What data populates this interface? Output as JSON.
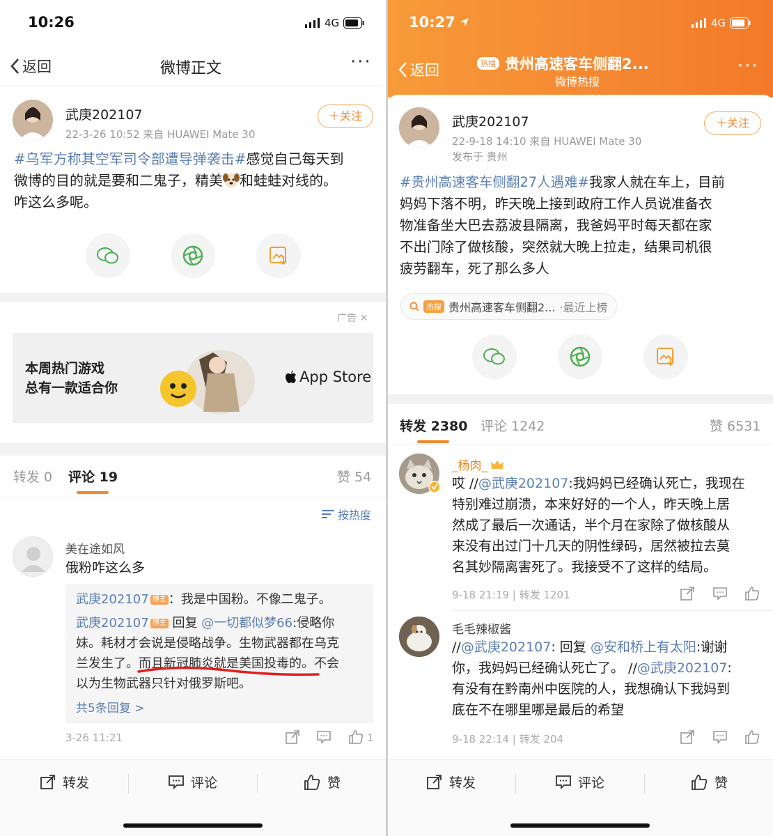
{
  "left": {
    "status": {
      "time": "10:26",
      "network": "4G"
    },
    "nav": {
      "back": "返回",
      "title": "微博正文",
      "more": "···"
    },
    "post": {
      "username": "武庚202107",
      "meta": "22-3-26 10:52  来自 HUAWEI Mate 30",
      "follow": "＋关注",
      "hashtag": "#乌军方称其空军司令部遭导弹袭击#",
      "text1": "感觉自己每天到",
      "text2a": "微博的目的就是要和二鬼子，精美",
      "text2b": "和蛙蛙对线的。",
      "text3": "咋这么多呢。"
    },
    "ad": {
      "label": "广告",
      "close": "✕",
      "line1": "本周热门游戏",
      "line2": "总有一款适合你",
      "store": "App Store"
    },
    "tabs": {
      "repost": "转发 0",
      "comment": "评论 19",
      "like": "赞 54",
      "sort": "按热度"
    },
    "comment": {
      "name": "美在途如风",
      "text": "俄粉咋这么多",
      "reply1_user": "武庚202107",
      "badge": "博主",
      "reply1_text": "：我是中国粉。不像二鬼子。",
      "reply2_user": "武庚202107",
      "reply2_pre": " 回复 ",
      "reply2_mention": "@一切都似梦66",
      "reply2_text1": ":侵略你",
      "reply2_line2": "妹。耗材才会说是侵略战争。生物武器都在乌克",
      "reply2_line3a": "兰发生了。",
      "reply2_line3b": "而且新冠肺炎就是美国投毒的",
      "reply2_line3c": "。不会",
      "reply2_line4": "以为生物武器只针对俄罗斯吧。",
      "more_replies": "共5条回复 >",
      "time": "3-26 11:21",
      "like_count": "1"
    },
    "bottom": {
      "repost": "转发",
      "comment": "评论",
      "like": "赞"
    }
  },
  "right": {
    "status": {
      "time": "10:27",
      "network": "4G"
    },
    "nav": {
      "back": "返回",
      "hot_tag": "热搜",
      "title": "贵州高速客车侧翻2...",
      "subtitle": "微博热搜",
      "more": "···"
    },
    "post": {
      "username": "武庚202107",
      "meta": "22-9-18 14:10  来自 HUAWEI Mate 30",
      "location": "发布于 贵州",
      "follow": "＋关注",
      "hashtag": "#贵州高速客车侧翻27人遇难#",
      "text1": "我家人就在车上，目前",
      "text2": "妈妈下落不明，昨天晚上接到政府工作人员说准备衣",
      "text3": "物准备坐大巴去荔波县隔离，我爸妈平时每天都在家",
      "text4": "不出门除了做核酸，突然就大晚上拉走，结果司机很",
      "text5": "疲劳翻车，死了那么多人"
    },
    "hot_chip": {
      "tag": "热搜",
      "text": "贵州高速客车侧翻2...",
      "suffix": "·最近上榜"
    },
    "tabs": {
      "repost": "转发 2380",
      "comment": "评论 1242",
      "like": "赞 6531"
    },
    "comment1": {
      "name": "_杨肉_",
      "pre": "哎 //",
      "mention": "@武庚202107",
      "line1": ":我妈妈已经确认死亡，我现在",
      "line2": "特别难过崩溃，本来好好的一个人，昨天晚上居",
      "line3": "然成了最后一次通话，半个月在家除了做核酸从",
      "line4": "来没有出过门十几天的阴性绿码，居然被拉去莫",
      "line5": "名其妙隔离害死了。我接受不了这样的结局。",
      "meta": "9-18 21:19 | 转发 1201"
    },
    "comment2": {
      "name": "毛毛辣椒酱",
      "pre": "//",
      "mention1": "@武庚202107",
      "mid": ": 回复 ",
      "mention2": "@安和桥上有太阳",
      "line1_end": ":谢谢",
      "line2a": "你，我妈妈已经确认死亡了。 //",
      "mention3": "@武庚202107",
      "line2b": ":",
      "line3": "有没有在黔南州中医院的人，我想确认下我妈到",
      "line4": "底在不在哪里哪是最后的希望",
      "meta": "9-18 22:14 | 转发 204"
    },
    "bottom": {
      "repost": "转发",
      "comment": "评论",
      "like": "赞"
    }
  }
}
